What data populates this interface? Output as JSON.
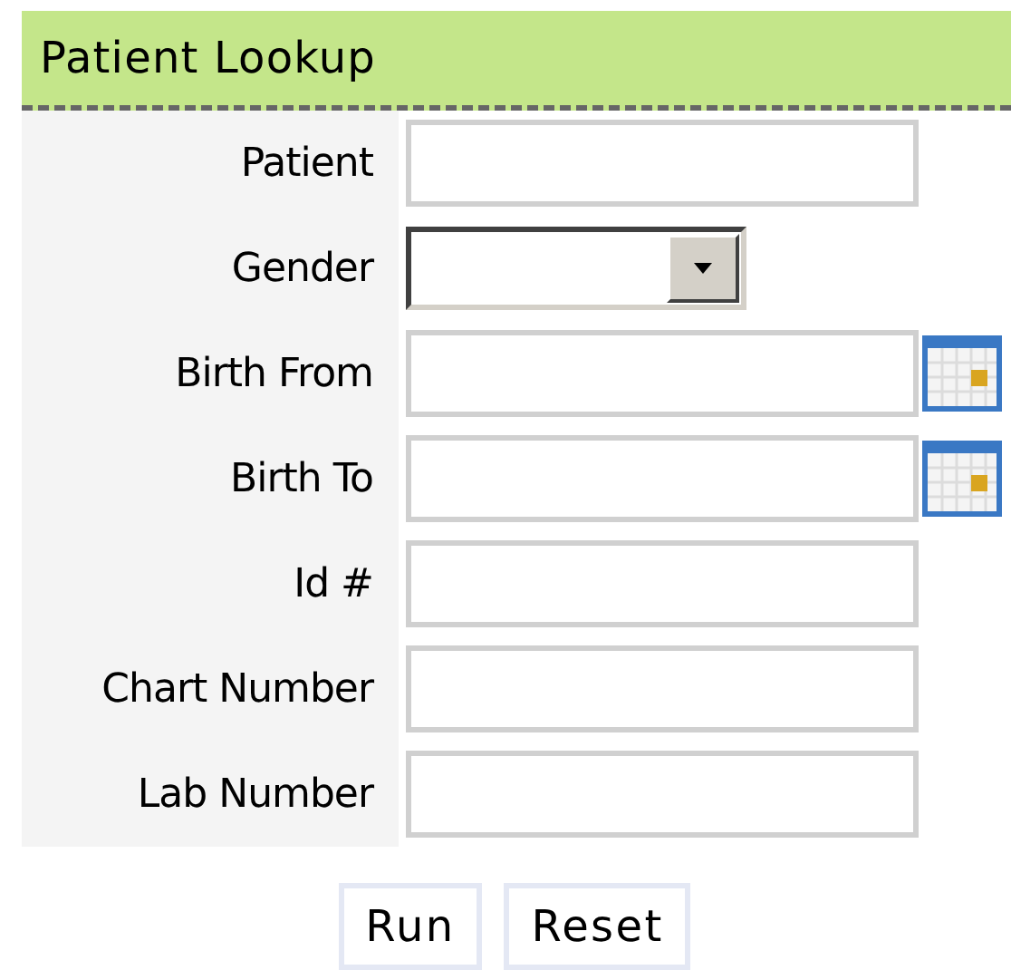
{
  "panel": {
    "title": "Patient Lookup"
  },
  "fields": [
    {
      "label": "Patient",
      "kind": "text"
    },
    {
      "label": "Gender",
      "kind": "select"
    },
    {
      "label": "Birth From",
      "kind": "date"
    },
    {
      "label": "Birth To",
      "kind": "date"
    },
    {
      "label": "Id #",
      "kind": "text"
    },
    {
      "label": "Chart Number",
      "kind": "text"
    },
    {
      "label": "Lab Number",
      "kind": "text"
    }
  ],
  "buttons": [
    "Run",
    "Reset"
  ]
}
